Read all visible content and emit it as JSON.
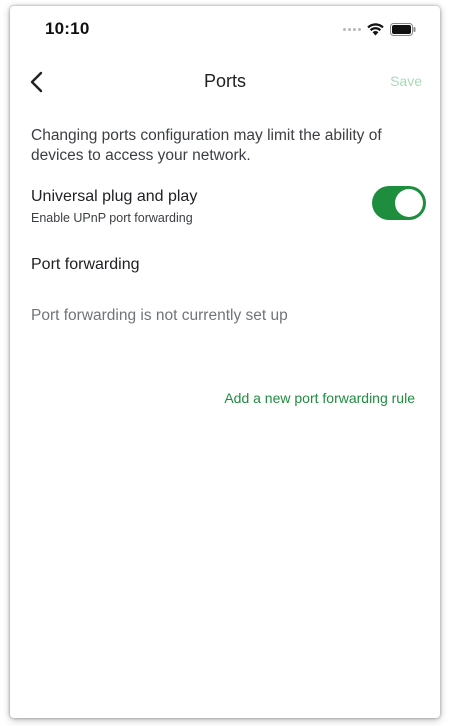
{
  "status_bar": {
    "time": "10:10",
    "icons": [
      "signal-dots-icon",
      "wifi-icon",
      "battery-icon"
    ]
  },
  "nav": {
    "back_icon": "chevron-left-icon",
    "title": "Ports",
    "save_label": "Save"
  },
  "main": {
    "warning": "Changing ports configuration may limit the ability of devices to access your network.",
    "upnp": {
      "title": "Universal plug and play",
      "subtitle": "Enable UPnP port forwarding",
      "enabled": true
    },
    "port_forwarding": {
      "heading": "Port forwarding",
      "empty_message": "Port forwarding is not currently set up",
      "add_rule_label": "Add a new port forwarding rule"
    }
  },
  "colors": {
    "accent": "#1e8e3e",
    "save_disabled": "#a8dbb7",
    "primary_text": "#202124",
    "secondary_text": "#70757a"
  }
}
